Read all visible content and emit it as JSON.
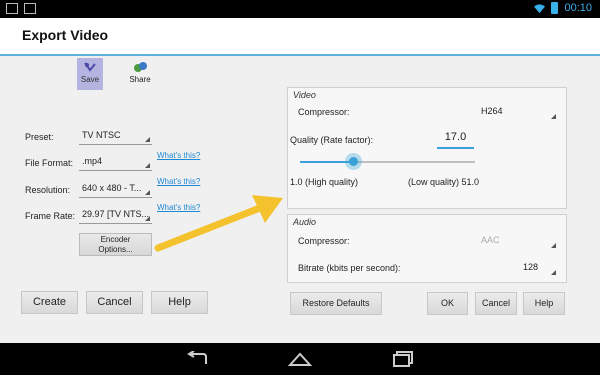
{
  "status": {
    "time": "00:10"
  },
  "window": {
    "title": "Export Video"
  },
  "toolbar": {
    "save_label": "Save",
    "share_label": "Share"
  },
  "form": {
    "preset_label": "Preset:",
    "preset_value": "TV NTSC",
    "file_format_label": "File Format:",
    "file_format_value": ".mp4",
    "resolution_label": "Resolution:",
    "resolution_value": "640 x 480 - T...",
    "frame_rate_label": "Frame Rate:",
    "frame_rate_value": "29.97 [TV NTS...",
    "whats_this": "What's this?",
    "encoder_options_label_1": "Encoder",
    "encoder_options_label_2": "Options..."
  },
  "buttons": {
    "create": "Create",
    "cancel": "Cancel",
    "help": "Help"
  },
  "video": {
    "title": "Video",
    "compressor_label": "Compressor:",
    "compressor_value": "H264",
    "quality_label": "Quality (Rate factor):",
    "quality_value": "17.0",
    "quality_slider_fraction": 0.3,
    "high_quality_label": "1.0 (High quality)",
    "low_quality_label": "(Low quality) 51.0"
  },
  "audio": {
    "title": "Audio",
    "compressor_label": "Compressor:",
    "compressor_value": "AAC",
    "bitrate_label": "Bitrate (kbits per second):",
    "bitrate_value": "128"
  },
  "dialog_buttons": {
    "restore_defaults": "Restore Defaults",
    "ok": "OK",
    "cancel": "Cancel",
    "help": "Help"
  },
  "colors": {
    "accent": "#3aa2d8",
    "arrow": "#f3c22d",
    "save_highlight": "#b5b3df"
  }
}
